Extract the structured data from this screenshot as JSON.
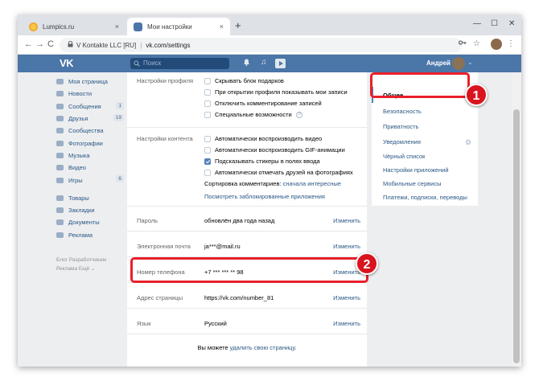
{
  "browser": {
    "tabs": [
      {
        "label": "Lumpics.ru",
        "close": "×"
      },
      {
        "label": "Мои настройки",
        "close": "×"
      }
    ],
    "new_tab": "+",
    "window_controls": {
      "minimize": "—",
      "maximize": "☐",
      "close": "✕"
    },
    "nav": {
      "back": "←",
      "forward": "→",
      "reload": "C"
    },
    "address": {
      "site": "V Kontakte LLC [RU]",
      "separator": "|",
      "url": "vk.com/settings"
    }
  },
  "vk_header": {
    "logo": "VK",
    "search_placeholder": "Поиск",
    "user_name": "Андрей"
  },
  "left_menu": {
    "items": [
      {
        "label": "Моя страница",
        "count": ""
      },
      {
        "label": "Новости",
        "count": ""
      },
      {
        "label": "Сообщения",
        "count": "1"
      },
      {
        "label": "Друзья",
        "count": "19"
      },
      {
        "label": "Сообщества",
        "count": ""
      },
      {
        "label": "Фотографии",
        "count": ""
      },
      {
        "label": "Музыка",
        "count": ""
      },
      {
        "label": "Видео",
        "count": ""
      },
      {
        "label": "Игры",
        "count": "6"
      }
    ],
    "items2": [
      {
        "label": "Товары"
      },
      {
        "label": "Закладки"
      },
      {
        "label": "Документы"
      },
      {
        "label": "Реклама"
      }
    ],
    "footer_line1": "Блог   Разработчикам",
    "footer_line2": "Реклама   Ещё ⌄"
  },
  "settings": {
    "profile": {
      "label": "Настройки профиля",
      "options": [
        {
          "text": "Скрывать блок подарков",
          "checked": false
        },
        {
          "text": "При открытии профиля показывать мои записи",
          "checked": false
        },
        {
          "text": "Отключить комментирование записей",
          "checked": false
        },
        {
          "text": "Специальные возможности",
          "checked": false
        }
      ],
      "help": "?"
    },
    "content": {
      "label": "Настройки контента",
      "options": [
        {
          "text": "Автоматически воспроизводить видео",
          "checked": false
        },
        {
          "text": "Автоматически воспроизводить GIF-анимации",
          "checked": false
        },
        {
          "text": "Подсказывать стикеры в полях ввода",
          "checked": true
        },
        {
          "text": "Автоматически отмечать друзей на фотографиях",
          "checked": false
        }
      ],
      "sort_label": "Сортировка комментариев:",
      "sort_value": "сначала интересные",
      "blocked_apps": "Посмотреть заблокированные приложения"
    },
    "fields": [
      {
        "label": "Пароль",
        "value": "обновлён два года назад",
        "action": "Изменить"
      },
      {
        "label": "Электронная почта",
        "value": "ja***@mail.ru",
        "action": "Изменить"
      },
      {
        "label": "Номер телефона",
        "value": "+7 *** *** ** 98",
        "action": "Изменить"
      },
      {
        "label": "Адрес страницы",
        "value": "https://vk.com/number_81",
        "action": "Изменить"
      },
      {
        "label": "Язык",
        "value": "Русский",
        "action": "Изменить"
      }
    ],
    "delete_text": "Вы можете",
    "delete_link": "удалить свою страницу."
  },
  "right_menu": {
    "items": [
      {
        "label": "Общее",
        "active": true
      },
      {
        "label": "Безопасность",
        "active": false
      },
      {
        "label": "Приватность",
        "active": false
      },
      {
        "label": "Уведомления",
        "active": false
      },
      {
        "label": "Чёрный список",
        "active": false
      },
      {
        "label": "Настройки приложений",
        "active": false
      },
      {
        "label": "Мобильные сервисы",
        "active": false
      },
      {
        "label": "Платежи, подписки, переводы",
        "active": false
      }
    ]
  },
  "annotations": {
    "badge1": "1",
    "badge2": "2",
    "highlight_color": "#e8202a"
  },
  "colors": {
    "vk_blue": "#4a76a8",
    "link": "#2a5885"
  }
}
